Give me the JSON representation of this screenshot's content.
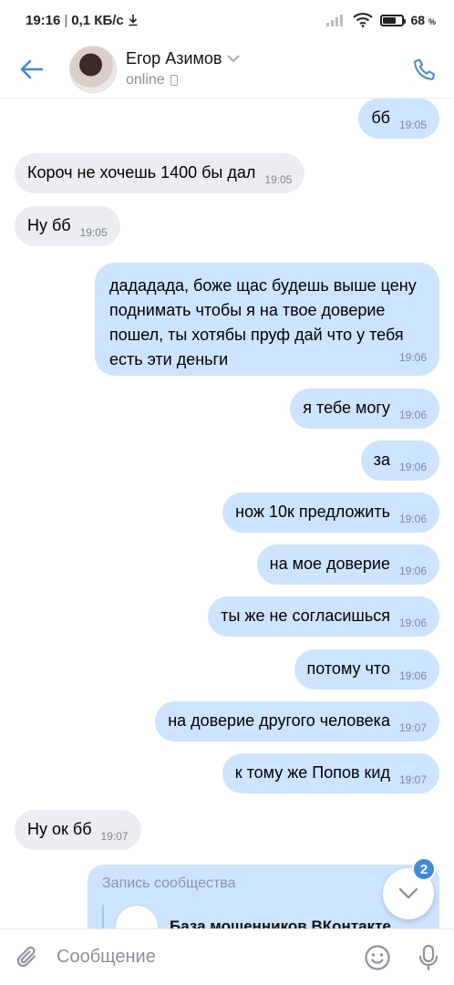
{
  "status_bar": {
    "time": "19:16",
    "network_speed": "0,1 КБ/с",
    "battery_percent": "68",
    "battery_unit": "%"
  },
  "header": {
    "contact_name": "Егор Азимов",
    "status": "online"
  },
  "messages": [
    {
      "dir": "out",
      "text": "бб",
      "time": "19:05"
    },
    {
      "dir": "in",
      "text": "Короч не хочешь 1400 бы дал",
      "time": "19:05"
    },
    {
      "dir": "in",
      "text": "Ну бб",
      "time": "19:05"
    },
    {
      "dir": "out",
      "text": "дададада, боже щас будешь выше цену поднимать чтобы я на твое доверие пошел, ты хотябы пруф дай что у тебя есть эти деньги",
      "time": "19:06"
    },
    {
      "dir": "out",
      "text": "я тебе могу",
      "time": "19:06"
    },
    {
      "dir": "out",
      "text": "за",
      "time": "19:06"
    },
    {
      "dir": "out",
      "text": "нож 10к предложить",
      "time": "19:06"
    },
    {
      "dir": "out",
      "text": "на мое доверие",
      "time": "19:06"
    },
    {
      "dir": "out",
      "text": "ты же не согласишься",
      "time": "19:06"
    },
    {
      "dir": "out",
      "text": "потому что",
      "time": "19:06"
    },
    {
      "dir": "out",
      "text": "на доверие другого человека",
      "time": "19:07"
    },
    {
      "dir": "out",
      "text": "к тому же Попов кид",
      "time": "19:07"
    },
    {
      "dir": "in",
      "text": "Ну ок бб",
      "time": "19:07"
    }
  ],
  "shared_post": {
    "label": "Запись сообщества",
    "title": "База мошенников ВКонтакте"
  },
  "scroll_button": {
    "unread_count": "2"
  },
  "composer": {
    "placeholder": "Сообщение"
  },
  "colors": {
    "accent": "#3f8ae0",
    "outgoing_bubble": "#cce4ff",
    "incoming_bubble": "#ebedf0"
  }
}
